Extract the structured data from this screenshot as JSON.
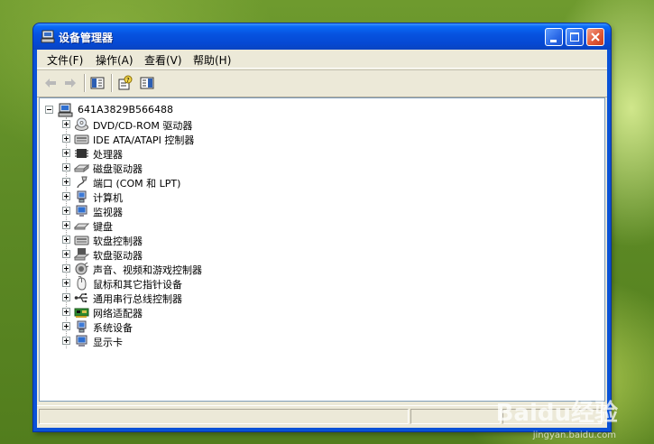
{
  "window": {
    "title": "设备管理器",
    "title_icon": "device-manager-icon"
  },
  "menu": [
    {
      "label": "文件(F)"
    },
    {
      "label": "操作(A)"
    },
    {
      "label": "查看(V)"
    },
    {
      "label": "帮助(H)"
    }
  ],
  "toolbar": {
    "buttons": [
      "back-arrow-icon",
      "forward-arrow-icon",
      "show-hide-console-tree-icon",
      "properties-help-icon",
      "show-hide-action-pane-icon"
    ]
  },
  "tree": {
    "root": "641A3829B566488",
    "items": [
      {
        "label": "DVD/CD-ROM 驱动器",
        "icon": "cdrom-drive-icon"
      },
      {
        "label": "IDE ATA/ATAPI 控制器",
        "icon": "ide-controller-icon"
      },
      {
        "label": "处理器",
        "icon": "processor-icon"
      },
      {
        "label": "磁盘驱动器",
        "icon": "disk-drive-icon"
      },
      {
        "label": "端口 (COM 和 LPT)",
        "icon": "port-icon"
      },
      {
        "label": "计算机",
        "icon": "computer-icon"
      },
      {
        "label": "监视器",
        "icon": "monitor-icon"
      },
      {
        "label": "键盘",
        "icon": "keyboard-icon"
      },
      {
        "label": "软盘控制器",
        "icon": "floppy-controller-icon"
      },
      {
        "label": "软盘驱动器",
        "icon": "floppy-drive-icon"
      },
      {
        "label": "声音、视频和游戏控制器",
        "icon": "sound-video-game-icon"
      },
      {
        "label": "鼠标和其它指针设备",
        "icon": "mouse-icon"
      },
      {
        "label": "通用串行总线控制器",
        "icon": "usb-icon"
      },
      {
        "label": "网络适配器",
        "icon": "network-adapter-icon"
      },
      {
        "label": "系统设备",
        "icon": "system-device-icon"
      },
      {
        "label": "显示卡",
        "icon": "display-adapter-icon"
      }
    ]
  },
  "watermark": {
    "brand": "Baidu经验",
    "url": "jingyan.baidu.com"
  }
}
